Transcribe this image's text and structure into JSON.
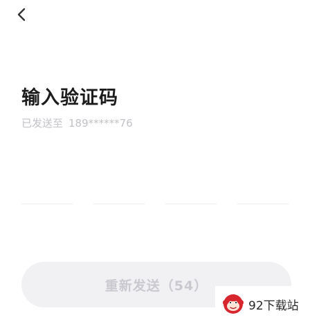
{
  "nav": {
    "back_icon": "chevron-left-icon"
  },
  "page": {
    "title": "输入验证码",
    "sent_prefix": "已发送至",
    "phone": "189******76"
  },
  "code_input": {
    "length": 4,
    "values": [
      "",
      "",
      "",
      ""
    ]
  },
  "resend_button": {
    "label": "重新发送（54）",
    "enabled": false
  },
  "watermark": {
    "text": "92下载站",
    "logo_icon": "monkey-logo-icon"
  },
  "colors": {
    "background": "#ffffff",
    "title": "#1c1c1c",
    "muted_text": "#c2c2c8",
    "button_bg": "#f1f1f4",
    "button_text": "#c9c9cf",
    "brand_red": "#d8262f"
  }
}
